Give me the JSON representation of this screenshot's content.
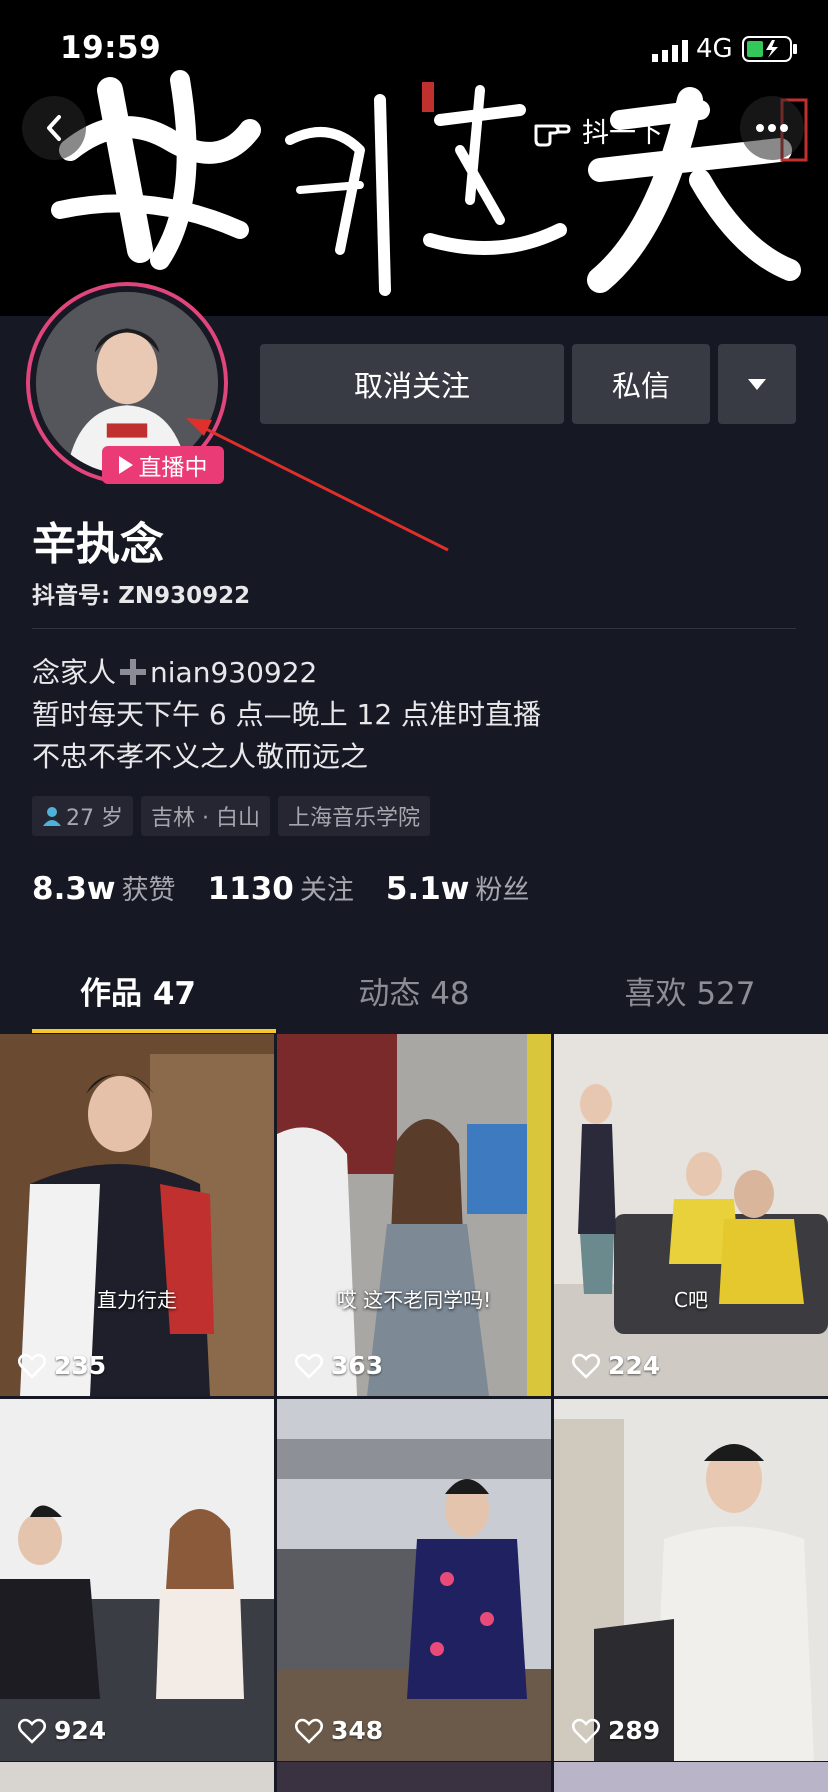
{
  "status_bar": {
    "time": "19:59",
    "network": "4G"
  },
  "banner": {
    "calligraphy": "勤酬道天",
    "douyin_label": "抖一下"
  },
  "profile": {
    "live_label": "直播中",
    "unfollow_label": "取消关注",
    "message_label": "私信",
    "nickname": "辛执念",
    "douyin_id": "抖音号: ZN930922",
    "bio": {
      "line1_prefix": "念家人",
      "line1_suffix": "nian930922",
      "line2": "暂时每天下午 6 点—晚上 12 点准时直播",
      "line3": "不忠不孝不义之人敬而远之"
    },
    "tags": {
      "age": "27 岁",
      "location": "吉林 · 白山",
      "school": "上海音乐学院"
    },
    "stats": {
      "likes_num": "8.3w",
      "likes_label": "获赞",
      "following_num": "1130",
      "following_label": "关注",
      "followers_num": "5.1w",
      "followers_label": "粉丝"
    }
  },
  "tabs": [
    {
      "label": "作品 47"
    },
    {
      "label": "动态 48"
    },
    {
      "label": "喜欢 527"
    }
  ],
  "videos": [
    {
      "likes": "235",
      "caption": "直力行走"
    },
    {
      "likes": "363",
      "caption": "哎 这不老同学吗!"
    },
    {
      "likes": "224",
      "caption": "C吧"
    },
    {
      "likes": "924",
      "caption": ""
    },
    {
      "likes": "348",
      "caption": ""
    },
    {
      "likes": "289",
      "caption": ""
    }
  ],
  "colors": {
    "background": "#161823",
    "accent_tab": "#f7c72f",
    "live": "#ea3b76",
    "button": "#393b44"
  },
  "icons": [
    "back-icon",
    "more-icon",
    "finger-point-icon",
    "play-icon",
    "person-icon",
    "plus-icon",
    "heart-icon",
    "caret-down-icon"
  ]
}
